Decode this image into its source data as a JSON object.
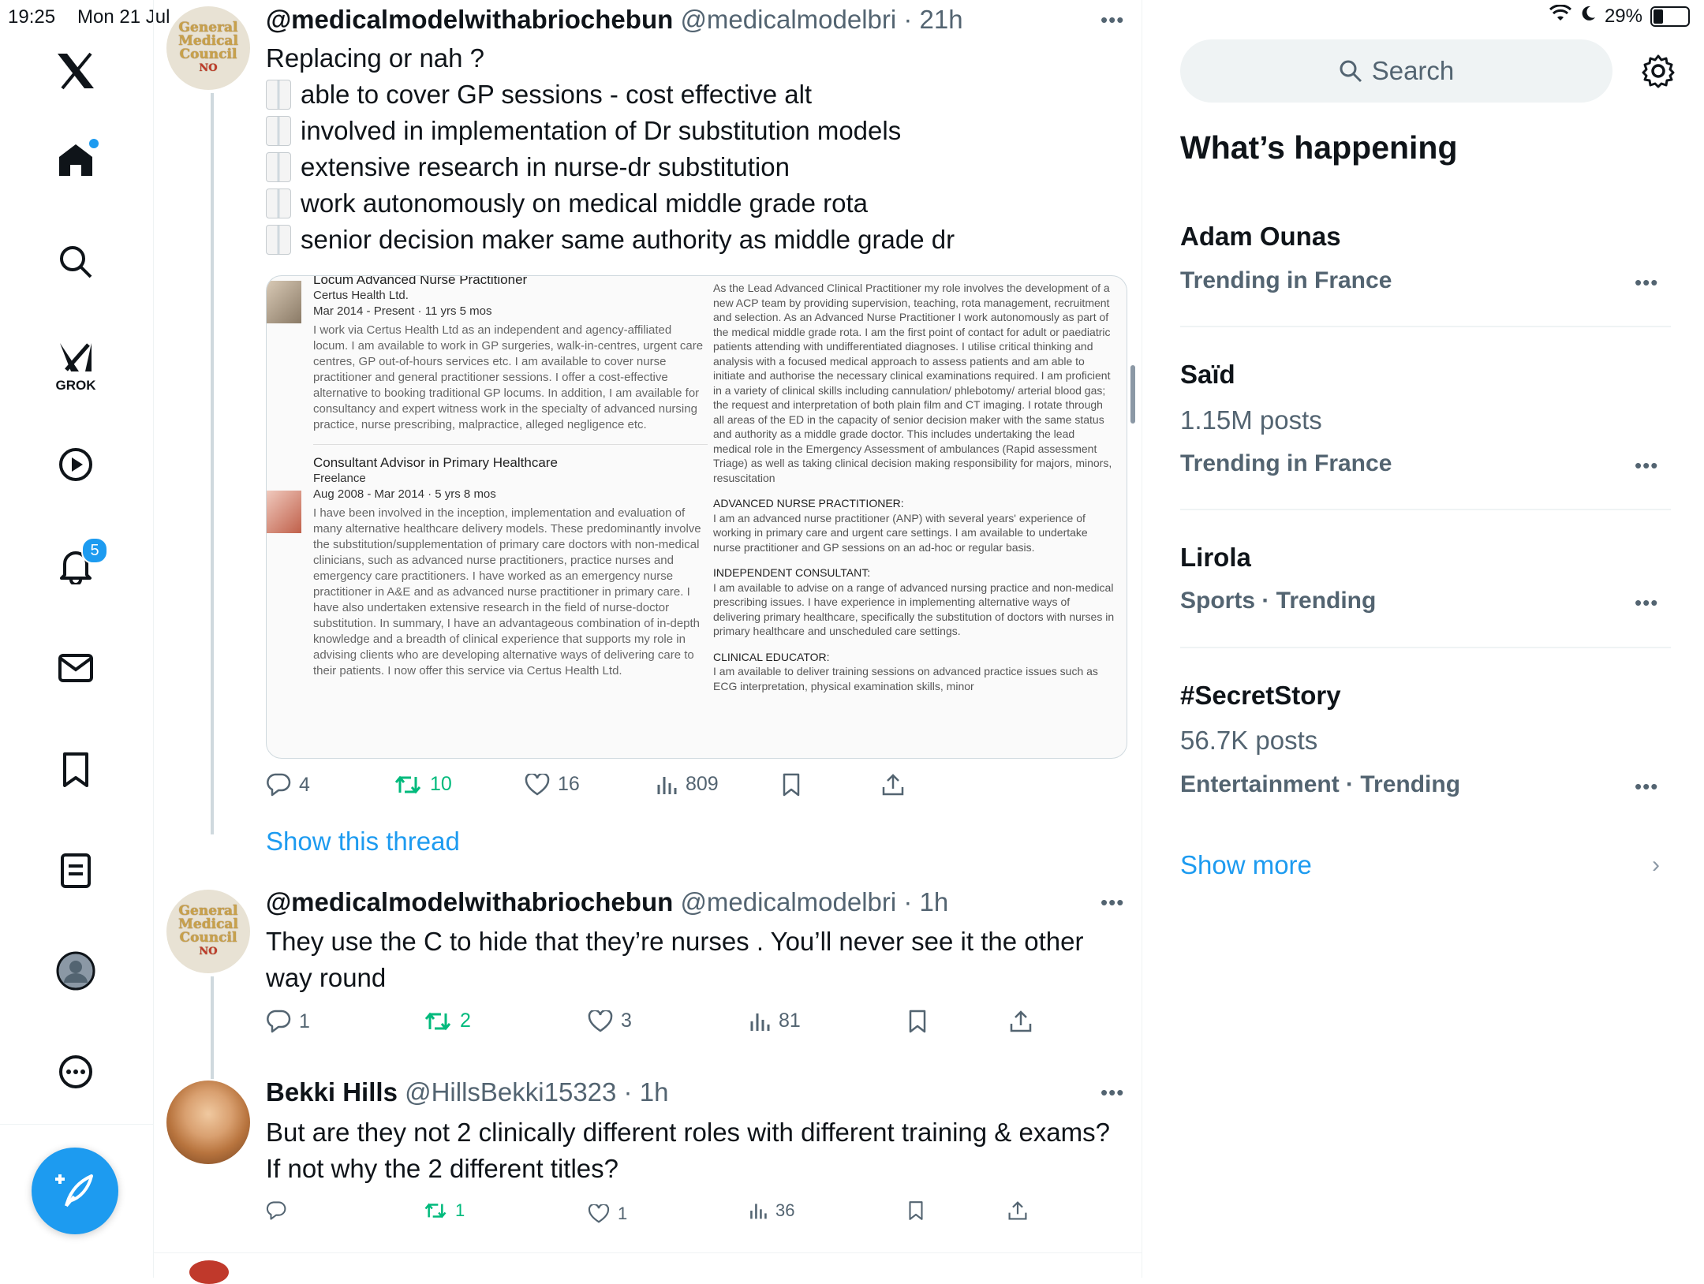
{
  "status_bar": {
    "time": "19:25",
    "date": "Mon 21 Jul",
    "battery": "29%"
  },
  "nav": {
    "grok_label": "GROK",
    "notifications_badge": "5"
  },
  "colors": {
    "accent": "#1d9bf0",
    "retweet": "#00ba7c",
    "secondary_text": "#536471"
  },
  "tweets": [
    {
      "name": "@medicalmodelwithabriochebun",
      "handle": "@medicalmodelbri",
      "time": "21h",
      "lines": [
        "Replacing or nah ?",
        "able to cover GP sessions - cost effective alt",
        "involved in implementation of Dr substitution models",
        "extensive research in nurse-dr substitution",
        "work autonomously on medical middle grade rota",
        "senior decision maker same authority as middle grade dr"
      ],
      "replies": "4",
      "reposts": "10",
      "likes": "16",
      "views": "809",
      "show_thread": "Show this thread"
    },
    {
      "name": "@medicalmodelwithabriochebun",
      "handle": "@medicalmodelbri",
      "time": "1h",
      "text": "They use the C to hide that they’re nurses . You’ll never see it the other way round",
      "replies": "1",
      "reposts": "2",
      "likes": "3",
      "views": "81"
    },
    {
      "name": "Bekki Hills",
      "handle": "@HillsBekki15323",
      "time": "1h",
      "text": "But are they not 2 clinically different roles with different training & exams? If not why the 2 different titles?",
      "replies": "",
      "reposts": "1",
      "likes": "1",
      "views": "36"
    }
  ],
  "media": {
    "left": {
      "job1_title": "Locum Advanced Nurse Practitioner",
      "job1_company": "Certus Health Ltd.",
      "job1_dates": "Mar 2014 - Present  ·  11 yrs 5 mos",
      "job1_desc": "I work via Certus Health Ltd as an independent and agency-affiliated locum. I am available to work in GP surgeries, walk-in-centres, urgent care centres, GP out-of-hours services etc. I am available to cover nurse practitioner and general practitioner sessions. I offer a cost-effective alternative to booking traditional GP locums. In addition, I am available for consultancy and expert witness work in the specialty of advanced nursing practice, nurse prescribing, malpractice, alleged negligence etc.",
      "job2_title": "Consultant Advisor in Primary Healthcare",
      "job2_company": "Freelance",
      "job2_dates": "Aug 2008 - Mar 2014  ·  5 yrs 8 mos",
      "job2_desc": "I have been involved in the inception, implementation and evaluation of many alternative healthcare delivery models. These predominantly involve the substitution/supplementation of primary care doctors with non-medical clinicians, such as advanced nurse practitioners, practice nurses and emergency care practitioners. I have worked as an emergency nurse practitioner in A&E and as advanced nurse practitioner in primary care. I have also undertaken extensive research in the field of nurse-doctor substitution. In summary, I have an advantageous combination of in-depth knowledge and a breadth of clinical experience that supports my role in advising clients who are developing alternative ways of delivering care to their patients. I now offer this service via Certus Health Ltd."
    },
    "right": {
      "p1": "As the Lead Advanced Clinical Practitioner my role involves the development of a new ACP team by providing supervision, teaching, rota management, recruitment and selection. As an Advanced Nurse Practitioner I work autonomously as part of the medical middle grade rota. I am the first point of contact for adult or paediatric patients attending with undifferentiated diagnoses. I utilise critical thinking and analysis with a focused medical approach to assess patients and am able to initiate and authorise the necessary clinical examinations required. I am proficient in a variety of clinical skills including cannulation/ phlebotomy/ arterial blood gas; the request and interpretation of both plain film and CT imaging. I rotate through all areas of the ED in the capacity of senior decision maker with the same status and authority as a middle grade doctor. This includes undertaking the lead medical role in the Emergency Assessment of ambulances (Rapid assessment Triage) as well as taking clinical decision making responsibility for majors, minors, resuscitation",
      "h2": "ADVANCED NURSE PRACTITIONER:",
      "p2": "I am an advanced nurse practitioner (ANP) with several years' experience of working in primary care and urgent care settings. I am available to undertake nurse practitioner and GP sessions on an ad-hoc or regular basis.",
      "h3": "INDEPENDENT CONSULTANT:",
      "p3": "I am available to advise on a range of advanced nursing practice and non-medical prescribing issues. I have experience in implementing alternative ways of delivering primary healthcare, specifically the substitution of doctors with nurses in primary healthcare and unscheduled care settings.",
      "h4": "CLINICAL EDUCATOR:",
      "p4": "I am available to deliver training sessions on advanced practice issues such as ECG interpretation, physical examination skills, minor"
    }
  },
  "sidebar": {
    "search_placeholder": "Search",
    "heading": "What’s happening",
    "trends": [
      {
        "name": "Adam Ounas",
        "meta": "Trending in France",
        "posts": ""
      },
      {
        "name": "Saïd",
        "posts": "1.15M posts",
        "meta": "Trending in France"
      },
      {
        "name": "Lirola",
        "meta": "Sports · Trending",
        "posts": ""
      },
      {
        "name": "#SecretStory",
        "posts": "56.7K posts",
        "meta": "Entertainment · Trending"
      }
    ],
    "show_more": "Show more"
  }
}
